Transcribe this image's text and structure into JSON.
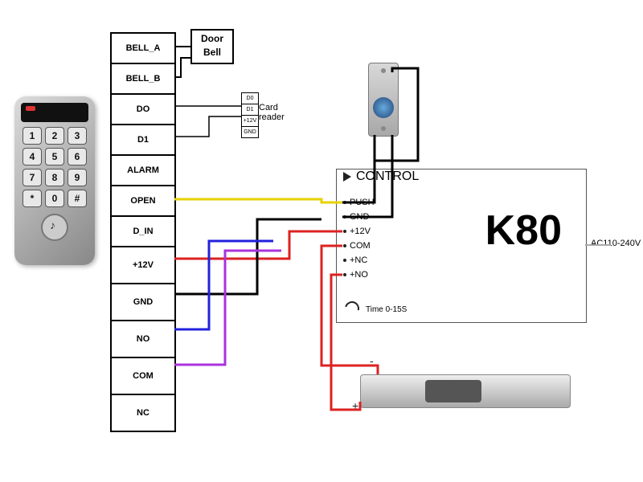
{
  "keypad": {
    "keys": [
      "1",
      "2",
      "3",
      "4",
      "5",
      "6",
      "7",
      "8",
      "9",
      "*",
      "0",
      "#"
    ]
  },
  "terminals": [
    "BELL_A",
    "BELL_B",
    "DO",
    "D1",
    "ALARM",
    "OPEN",
    "D_IN",
    "+12V",
    "GND",
    "NO",
    "COM",
    "NC"
  ],
  "doorbell": {
    "label": "Door Bell"
  },
  "card_reader": {
    "pins": [
      "D0",
      "D1",
      "+12V",
      "GND"
    ],
    "label": "Card reader"
  },
  "k80": {
    "title": "K80",
    "control_label": "CONTROL",
    "pins": [
      "PUSH",
      "GND",
      "+12V",
      "COM",
      "+NC",
      "+NO"
    ],
    "time_label": "Time 0-15S",
    "ac_label": "AC110-240V"
  },
  "lock_polarity": {
    "plus": "+",
    "minus": "-"
  },
  "wiring": [
    {
      "from": "keypad.D0",
      "to": "card_reader.D0"
    },
    {
      "from": "keypad.D1",
      "to": "card_reader.D1"
    },
    {
      "from": "keypad.OPEN",
      "to": "k80.PUSH",
      "color": "yellow"
    },
    {
      "from": "keypad.OPEN",
      "to": "exit_button",
      "color": "black"
    },
    {
      "from": "keypad.+12V",
      "to": "k80.+12V",
      "color": "red"
    },
    {
      "from": "keypad.GND",
      "to": "k80.GND",
      "color": "black"
    },
    {
      "from": "keypad.GND",
      "to": "exit_button",
      "color": "black"
    },
    {
      "from": "keypad.NO",
      "to": "lock",
      "color": "blue"
    },
    {
      "from": "keypad.COM",
      "to": "lock",
      "color": "purple"
    },
    {
      "from": "k80.COM",
      "to": "lock.-",
      "color": "red"
    },
    {
      "from": "k80.+NO",
      "to": "lock.+",
      "color": "red"
    },
    {
      "from": "k80",
      "to": "AC110-240V",
      "color": "gray"
    }
  ]
}
